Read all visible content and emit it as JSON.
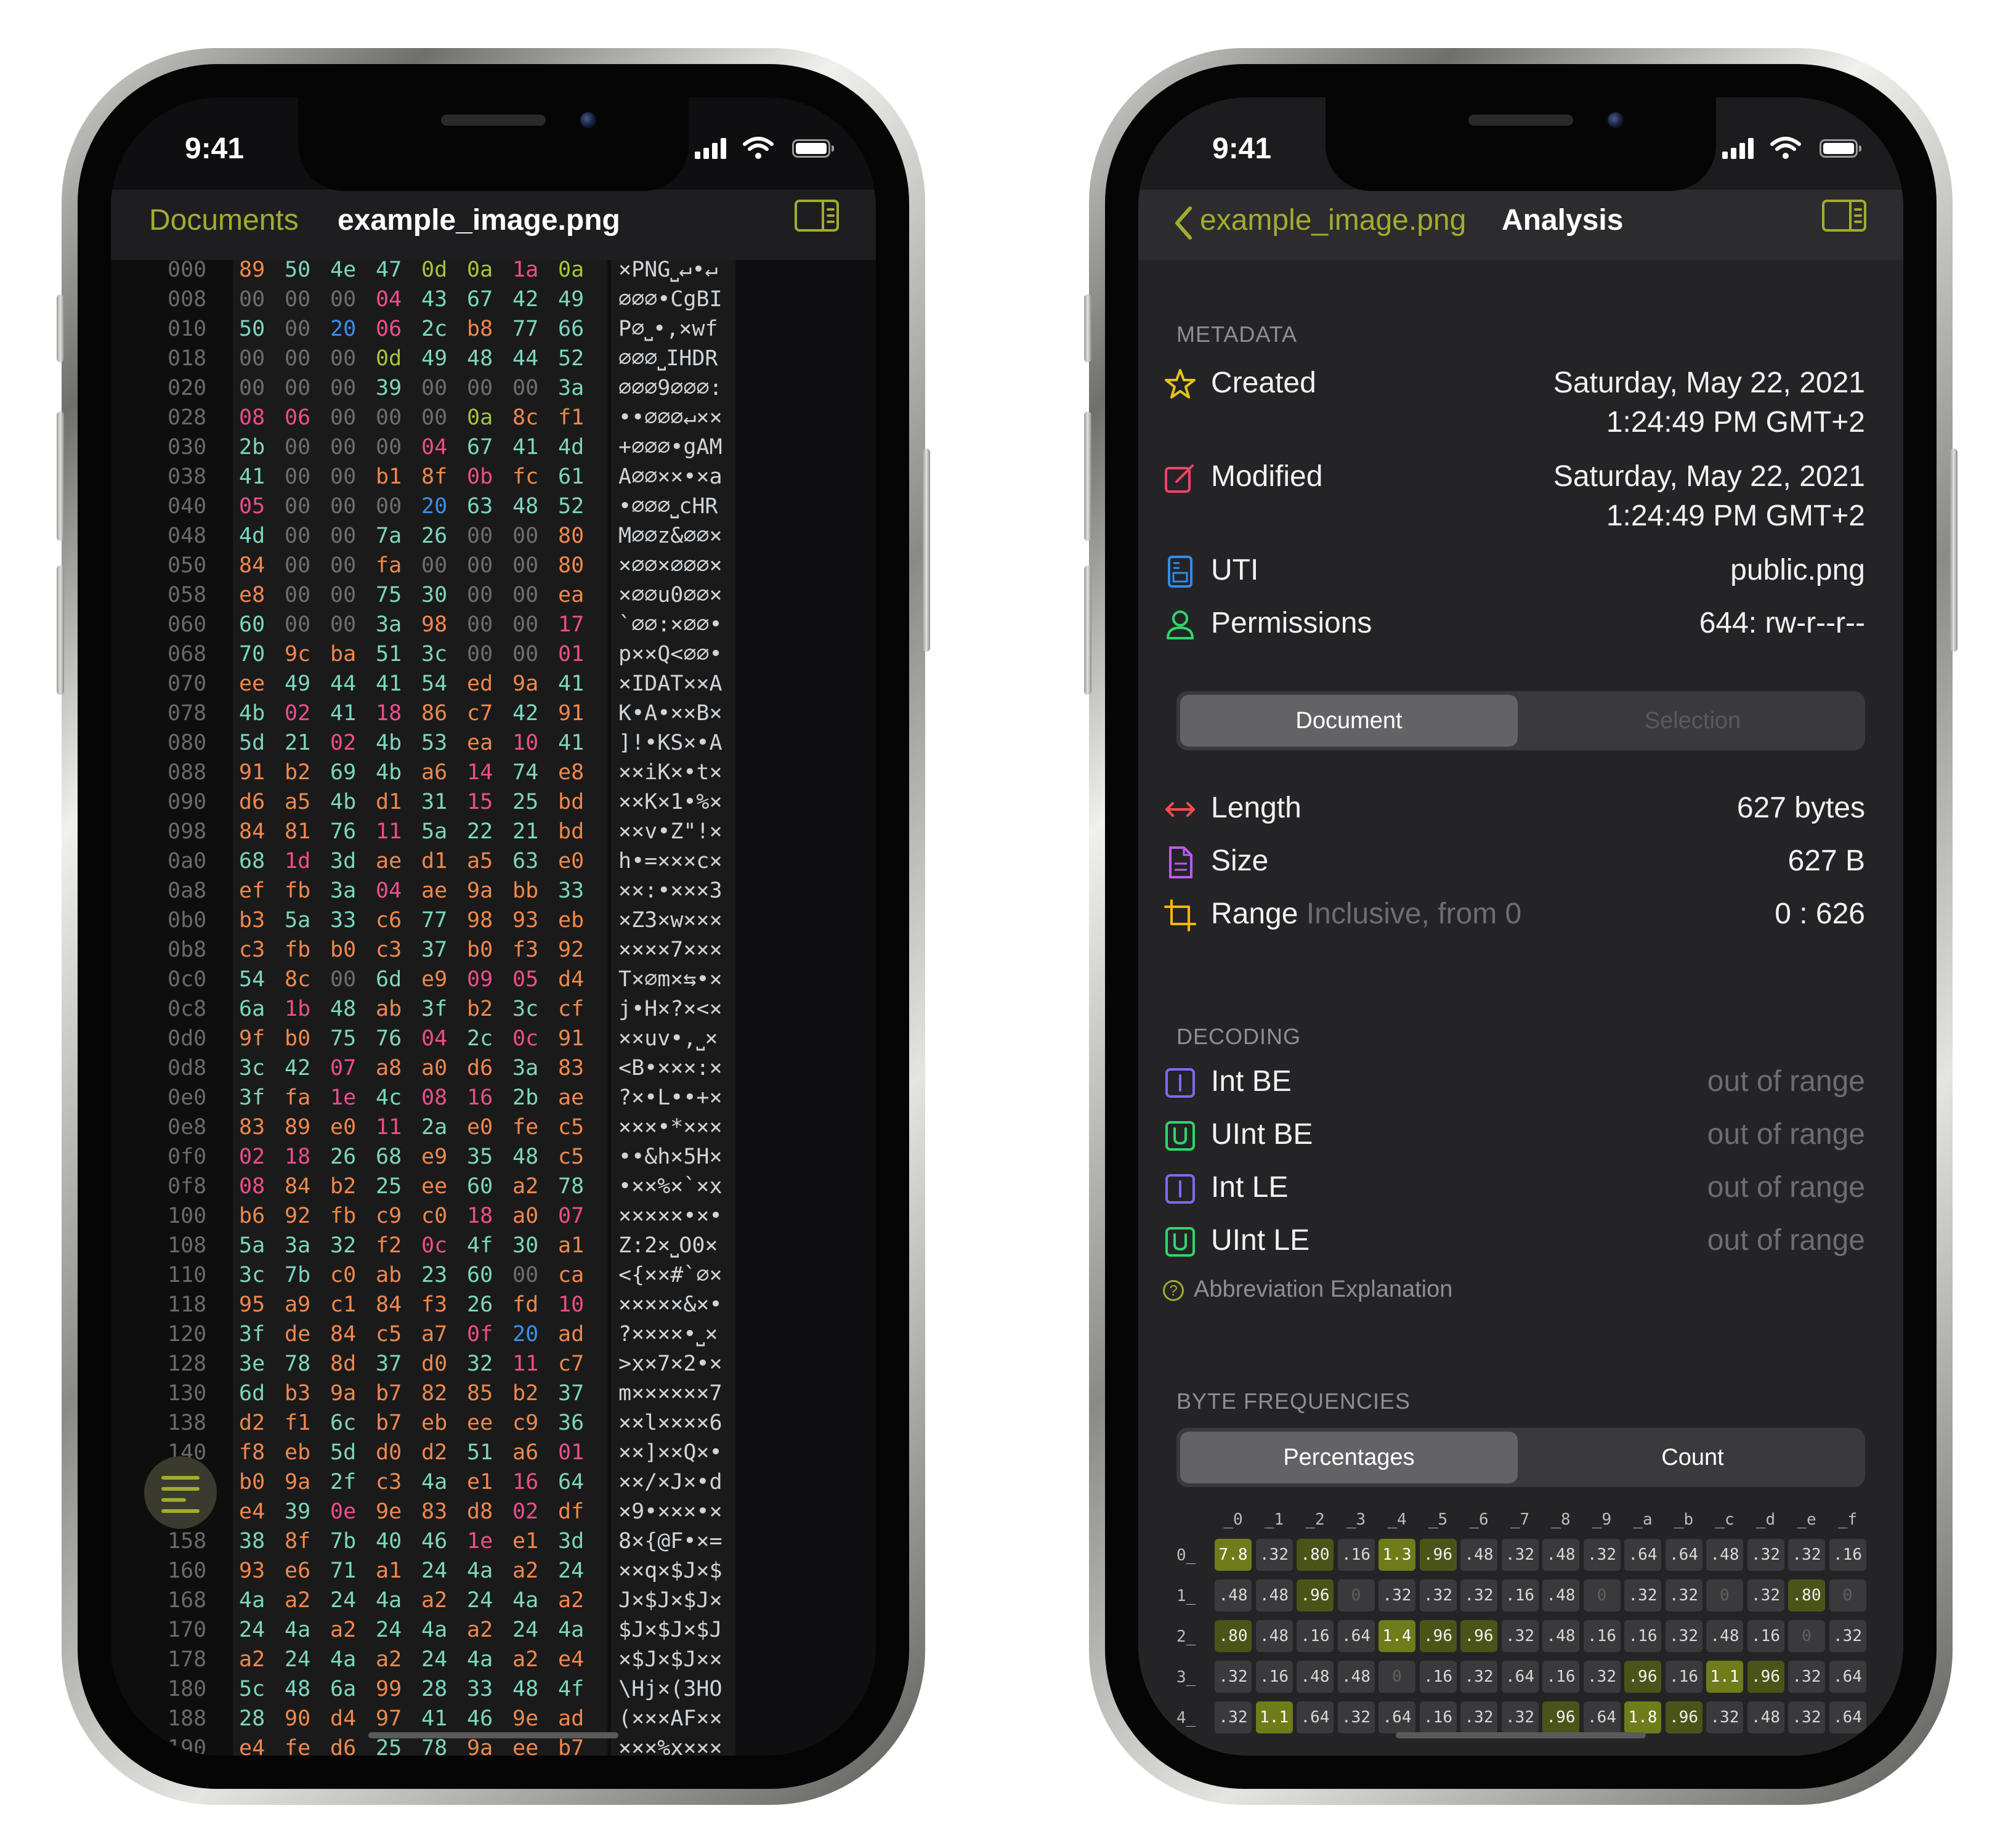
{
  "status": {
    "time": "9:41"
  },
  "hex_view": {
    "nav": {
      "back_label": "Documents",
      "title": "example_image.png"
    },
    "rows": [
      {
        "off": "000",
        "bytes": [
          "89",
          "50",
          "4e",
          "47",
          "0d",
          "0a",
          "1a",
          "0a"
        ],
        "ascii": "×PNG⎵↵•↵"
      },
      {
        "off": "008",
        "bytes": [
          "00",
          "00",
          "00",
          "04",
          "43",
          "67",
          "42",
          "49"
        ],
        "ascii": "⌀⌀⌀•CgBI"
      },
      {
        "off": "010",
        "bytes": [
          "50",
          "00",
          "20",
          "06",
          "2c",
          "b8",
          "77",
          "66"
        ],
        "ascii": "P⌀⎵•,×wf"
      },
      {
        "off": "018",
        "bytes": [
          "00",
          "00",
          "00",
          "0d",
          "49",
          "48",
          "44",
          "52"
        ],
        "ascii": "⌀⌀⌀⎵IHDR"
      },
      {
        "off": "020",
        "bytes": [
          "00",
          "00",
          "00",
          "39",
          "00",
          "00",
          "00",
          "3a"
        ],
        "ascii": "⌀⌀⌀9⌀⌀⌀:"
      },
      {
        "off": "028",
        "bytes": [
          "08",
          "06",
          "00",
          "00",
          "00",
          "0a",
          "8c",
          "f1"
        ],
        "ascii": "••⌀⌀⌀↵××"
      },
      {
        "off": "030",
        "bytes": [
          "2b",
          "00",
          "00",
          "00",
          "04",
          "67",
          "41",
          "4d"
        ],
        "ascii": "+⌀⌀⌀•gAM"
      },
      {
        "off": "038",
        "bytes": [
          "41",
          "00",
          "00",
          "b1",
          "8f",
          "0b",
          "fc",
          "61"
        ],
        "ascii": "A⌀⌀××•×a"
      },
      {
        "off": "040",
        "bytes": [
          "05",
          "00",
          "00",
          "00",
          "20",
          "63",
          "48",
          "52"
        ],
        "ascii": "•⌀⌀⌀⎵cHR"
      },
      {
        "off": "048",
        "bytes": [
          "4d",
          "00",
          "00",
          "7a",
          "26",
          "00",
          "00",
          "80"
        ],
        "ascii": "M⌀⌀z&⌀⌀×"
      },
      {
        "off": "050",
        "bytes": [
          "84",
          "00",
          "00",
          "fa",
          "00",
          "00",
          "00",
          "80"
        ],
        "ascii": "×⌀⌀×⌀⌀⌀×"
      },
      {
        "off": "058",
        "bytes": [
          "e8",
          "00",
          "00",
          "75",
          "30",
          "00",
          "00",
          "ea"
        ],
        "ascii": "×⌀⌀u0⌀⌀×"
      },
      {
        "off": "060",
        "bytes": [
          "60",
          "00",
          "00",
          "3a",
          "98",
          "00",
          "00",
          "17"
        ],
        "ascii": "`⌀⌀:×⌀⌀•"
      },
      {
        "off": "068",
        "bytes": [
          "70",
          "9c",
          "ba",
          "51",
          "3c",
          "00",
          "00",
          "01"
        ],
        "ascii": "p××Q<⌀⌀•"
      },
      {
        "off": "070",
        "bytes": [
          "ee",
          "49",
          "44",
          "41",
          "54",
          "ed",
          "9a",
          "41"
        ],
        "ascii": "×IDAT××A"
      },
      {
        "off": "078",
        "bytes": [
          "4b",
          "02",
          "41",
          "18",
          "86",
          "c7",
          "42",
          "91"
        ],
        "ascii": "K•A•××B×"
      },
      {
        "off": "080",
        "bytes": [
          "5d",
          "21",
          "02",
          "4b",
          "53",
          "ea",
          "10",
          "41"
        ],
        "ascii": "]!•KS×•A"
      },
      {
        "off": "088",
        "bytes": [
          "91",
          "b2",
          "69",
          "4b",
          "a6",
          "14",
          "74",
          "e8"
        ],
        "ascii": "××iK×•t×"
      },
      {
        "off": "090",
        "bytes": [
          "d6",
          "a5",
          "4b",
          "d1",
          "31",
          "15",
          "25",
          "bd"
        ],
        "ascii": "××K×1•%×"
      },
      {
        "off": "098",
        "bytes": [
          "84",
          "81",
          "76",
          "11",
          "5a",
          "22",
          "21",
          "bd"
        ],
        "ascii": "××v•Z\"!×"
      },
      {
        "off": "0a0",
        "bytes": [
          "68",
          "1d",
          "3d",
          "ae",
          "d1",
          "a5",
          "63",
          "e0"
        ],
        "ascii": "h•=×××c×"
      },
      {
        "off": "0a8",
        "bytes": [
          "ef",
          "fb",
          "3a",
          "04",
          "ae",
          "9a",
          "bb",
          "33"
        ],
        "ascii": "××:•×××3"
      },
      {
        "off": "0b0",
        "bytes": [
          "b3",
          "5a",
          "33",
          "c6",
          "77",
          "98",
          "93",
          "eb"
        ],
        "ascii": "×Z3×w×××"
      },
      {
        "off": "0b8",
        "bytes": [
          "c3",
          "fb",
          "b0",
          "c3",
          "37",
          "b0",
          "f3",
          "92"
        ],
        "ascii": "××××7×××"
      },
      {
        "off": "0c0",
        "bytes": [
          "54",
          "8c",
          "00",
          "6d",
          "e9",
          "09",
          "05",
          "d4"
        ],
        "ascii": "T×⌀m×⇆•×"
      },
      {
        "off": "0c8",
        "bytes": [
          "6a",
          "1b",
          "48",
          "ab",
          "3f",
          "b2",
          "3c",
          "cf"
        ],
        "ascii": "j•H×?×<×"
      },
      {
        "off": "0d0",
        "bytes": [
          "9f",
          "b0",
          "75",
          "76",
          "04",
          "2c",
          "0c",
          "91"
        ],
        "ascii": "××uv•,⎵×"
      },
      {
        "off": "0d8",
        "bytes": [
          "3c",
          "42",
          "07",
          "a8",
          "a0",
          "d6",
          "3a",
          "83"
        ],
        "ascii": "<B•×××:×"
      },
      {
        "off": "0e0",
        "bytes": [
          "3f",
          "fa",
          "1e",
          "4c",
          "08",
          "16",
          "2b",
          "ae"
        ],
        "ascii": "?×•L••+×"
      },
      {
        "off": "0e8",
        "bytes": [
          "83",
          "89",
          "e0",
          "11",
          "2a",
          "e0",
          "fe",
          "c5"
        ],
        "ascii": "×××•*×××"
      },
      {
        "off": "0f0",
        "bytes": [
          "02",
          "18",
          "26",
          "68",
          "e9",
          "35",
          "48",
          "c5"
        ],
        "ascii": "••&h×5H×"
      },
      {
        "off": "0f8",
        "bytes": [
          "08",
          "84",
          "b2",
          "25",
          "ee",
          "60",
          "a2",
          "78"
        ],
        "ascii": "•××%×`×x"
      },
      {
        "off": "100",
        "bytes": [
          "b6",
          "92",
          "fb",
          "c9",
          "c0",
          "18",
          "a0",
          "07"
        ],
        "ascii": "×××××•×•"
      },
      {
        "off": "108",
        "bytes": [
          "5a",
          "3a",
          "32",
          "f2",
          "0c",
          "4f",
          "30",
          "a1"
        ],
        "ascii": "Z:2×⎵O0×"
      },
      {
        "off": "110",
        "bytes": [
          "3c",
          "7b",
          "c0",
          "ab",
          "23",
          "60",
          "00",
          "ca"
        ],
        "ascii": "<{××#`⌀×"
      },
      {
        "off": "118",
        "bytes": [
          "95",
          "a9",
          "c1",
          "84",
          "f3",
          "26",
          "fd",
          "10"
        ],
        "ascii": "×××××&×•"
      },
      {
        "off": "120",
        "bytes": [
          "3f",
          "de",
          "84",
          "c5",
          "a7",
          "0f",
          "20",
          "ad"
        ],
        "ascii": "?××××•⎵×"
      },
      {
        "off": "128",
        "bytes": [
          "3e",
          "78",
          "8d",
          "37",
          "d0",
          "32",
          "11",
          "c7"
        ],
        "ascii": ">x×7×2•×"
      },
      {
        "off": "130",
        "bytes": [
          "6d",
          "b3",
          "9a",
          "b7",
          "82",
          "85",
          "b2",
          "37"
        ],
        "ascii": "m××××××7"
      },
      {
        "off": "138",
        "bytes": [
          "d2",
          "f1",
          "6c",
          "b7",
          "eb",
          "ee",
          "c9",
          "36"
        ],
        "ascii": "××l××××6"
      },
      {
        "off": "140",
        "bytes": [
          "f8",
          "eb",
          "5d",
          "d0",
          "d2",
          "51",
          "a6",
          "01"
        ],
        "ascii": "××]××Q×•"
      },
      {
        "off": "148",
        "bytes": [
          "b0",
          "9a",
          "2f",
          "c3",
          "4a",
          "e1",
          "16",
          "64"
        ],
        "ascii": "××/×J×•d"
      },
      {
        "off": "150",
        "bytes": [
          "e4",
          "39",
          "0e",
          "9e",
          "83",
          "d8",
          "02",
          "df"
        ],
        "ascii": "×9•×××•×"
      },
      {
        "off": "158",
        "bytes": [
          "38",
          "8f",
          "7b",
          "40",
          "46",
          "1e",
          "e1",
          "3d"
        ],
        "ascii": "8×{@F•×="
      },
      {
        "off": "160",
        "bytes": [
          "93",
          "e6",
          "71",
          "a1",
          "24",
          "4a",
          "a2",
          "24"
        ],
        "ascii": "××q×$J×$"
      },
      {
        "off": "168",
        "bytes": [
          "4a",
          "a2",
          "24",
          "4a",
          "a2",
          "24",
          "4a",
          "a2"
        ],
        "ascii": "J×$J×$J×"
      },
      {
        "off": "170",
        "bytes": [
          "24",
          "4a",
          "a2",
          "24",
          "4a",
          "a2",
          "24",
          "4a"
        ],
        "ascii": "$J×$J×$J"
      },
      {
        "off": "178",
        "bytes": [
          "a2",
          "24",
          "4a",
          "a2",
          "24",
          "4a",
          "a2",
          "e4"
        ],
        "ascii": "×$J×$J××"
      },
      {
        "off": "180",
        "bytes": [
          "5c",
          "48",
          "6a",
          "99",
          "28",
          "33",
          "48",
          "4f"
        ],
        "ascii": "\\Hj×(3HO"
      },
      {
        "off": "188",
        "bytes": [
          "28",
          "90",
          "d4",
          "97",
          "41",
          "46",
          "9e",
          "ad"
        ],
        "ascii": "(×××AF××"
      },
      {
        "off": "190",
        "bytes": [
          "e4",
          "fe",
          "d6",
          "25",
          "78",
          "9a",
          "ee",
          "b7"
        ],
        "ascii": "×××%x×××"
      }
    ],
    "colors": {
      "null": "#6e6e6e",
      "control": "#ee4d8b",
      "whitespace": "#3a8ee8",
      "printable": "#7cd6bd",
      "high": "#f0884e",
      "newline": "#a4c63a"
    }
  },
  "analysis": {
    "nav": {
      "back_label": "example_image.png",
      "title": "Analysis"
    },
    "metadata": {
      "header": "METADATA",
      "rows": [
        {
          "icon": "star-icon",
          "label": "Created",
          "value": "Saturday, May 22, 2021",
          "value2": "1:24:49 PM GMT+2"
        },
        {
          "icon": "edit-icon",
          "label": "Modified",
          "value": "Saturday, May 22, 2021",
          "value2": "1:24:49 PM GMT+2"
        },
        {
          "icon": "document-type-icon",
          "label": "UTI",
          "value": "public.png"
        },
        {
          "icon": "person-icon",
          "label": "Permissions",
          "value": "644: rw-r--r--"
        }
      ]
    },
    "scope_segment": {
      "options": [
        "Document",
        "Selection"
      ],
      "selected": "Document"
    },
    "document_stats": [
      {
        "icon": "length-arrows-icon",
        "label": "Length",
        "value": "627 bytes"
      },
      {
        "icon": "file-icon",
        "label": "Size",
        "value": "627 B"
      },
      {
        "icon": "range-crop-icon",
        "label": "Range",
        "sub": "Inclusive, from 0",
        "value": "0 : 626"
      }
    ],
    "decoding": {
      "header": "DECODING",
      "rows": [
        {
          "icon": "int-icon",
          "badge": "I",
          "label": "Int BE",
          "value": "out of range"
        },
        {
          "icon": "uint-icon",
          "badge": "U",
          "label": "UInt BE",
          "value": "out of range"
        },
        {
          "icon": "int-icon",
          "badge": "I",
          "label": "Int LE",
          "value": "out of range"
        },
        {
          "icon": "uint-icon",
          "badge": "U",
          "label": "UInt LE",
          "value": "out of range"
        }
      ],
      "help_label": "Abbreviation Explanation"
    },
    "byte_frequencies": {
      "header": "BYTE FREQUENCIES",
      "segment": {
        "options": [
          "Percentages",
          "Count"
        ],
        "selected": "Percentages"
      },
      "col_headers": [
        "_0",
        "_1",
        "_2",
        "_3",
        "_4",
        "_5",
        "_6",
        "_7",
        "_8",
        "_9",
        "_a",
        "_b",
        "_c",
        "_d",
        "_e",
        "_f"
      ],
      "rows": [
        {
          "label": "0_",
          "values": [
            "7.8",
            ".32",
            ".80",
            ".16",
            "1.3",
            ".96",
            ".48",
            ".32",
            ".48",
            ".32",
            ".64",
            ".64",
            ".48",
            ".32",
            ".32",
            ".16"
          ]
        },
        {
          "label": "1_",
          "values": [
            ".48",
            ".48",
            ".96",
            "0",
            ".32",
            ".32",
            ".32",
            ".16",
            ".48",
            "0",
            ".32",
            ".32",
            "0",
            ".32",
            ".80",
            "0"
          ]
        },
        {
          "label": "2_",
          "values": [
            ".80",
            ".48",
            ".16",
            ".64",
            "1.4",
            ".96",
            ".96",
            ".32",
            ".48",
            ".16",
            ".16",
            ".32",
            ".48",
            ".16",
            "0",
            ".32"
          ]
        },
        {
          "label": "3_",
          "values": [
            ".32",
            ".16",
            ".48",
            ".48",
            "0",
            ".16",
            ".32",
            ".64",
            ".16",
            ".32",
            ".96",
            ".16",
            "1.1",
            ".96",
            ".32",
            ".64"
          ]
        },
        {
          "label": "4_",
          "values": [
            ".32",
            "1.1",
            ".64",
            ".32",
            ".64",
            ".16",
            ".32",
            ".32",
            ".96",
            ".64",
            "1.8",
            ".96",
            ".32",
            ".48",
            ".32",
            ".64"
          ]
        }
      ]
    }
  }
}
